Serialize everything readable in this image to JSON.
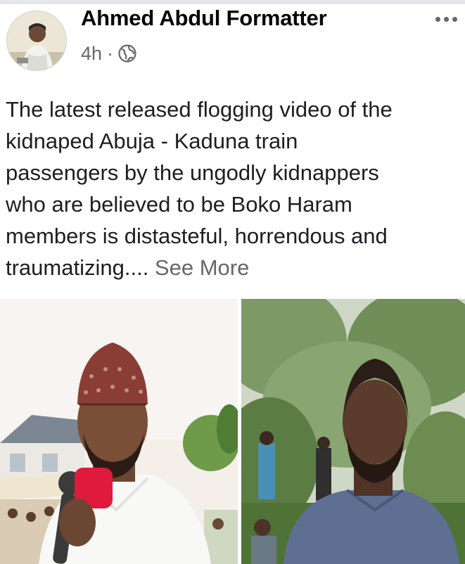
{
  "post": {
    "author_name": "Ahmed Abdul Formatter",
    "timestamp": "4h",
    "separator": "·",
    "audience_icon": "globe-icon",
    "more_icon": "more-horizontal-icon",
    "body_text": "The latest released flogging video of the\nkidnaped Abuja - Kaduna train\npassengers  by the ungodly kidnappers\nwho are believed to be Boko Haram\nmembers  is distasteful,  horrendous and\ntraumatizing.... ",
    "see_more_label": "See More"
  },
  "photos": [
    {
      "name": "photo-man-with-microphone"
    },
    {
      "name": "photo-bearded-man-outdoors"
    }
  ],
  "colors": {
    "text_primary": "#1c1e21",
    "text_secondary": "#65676b",
    "background": "#ffffff"
  }
}
